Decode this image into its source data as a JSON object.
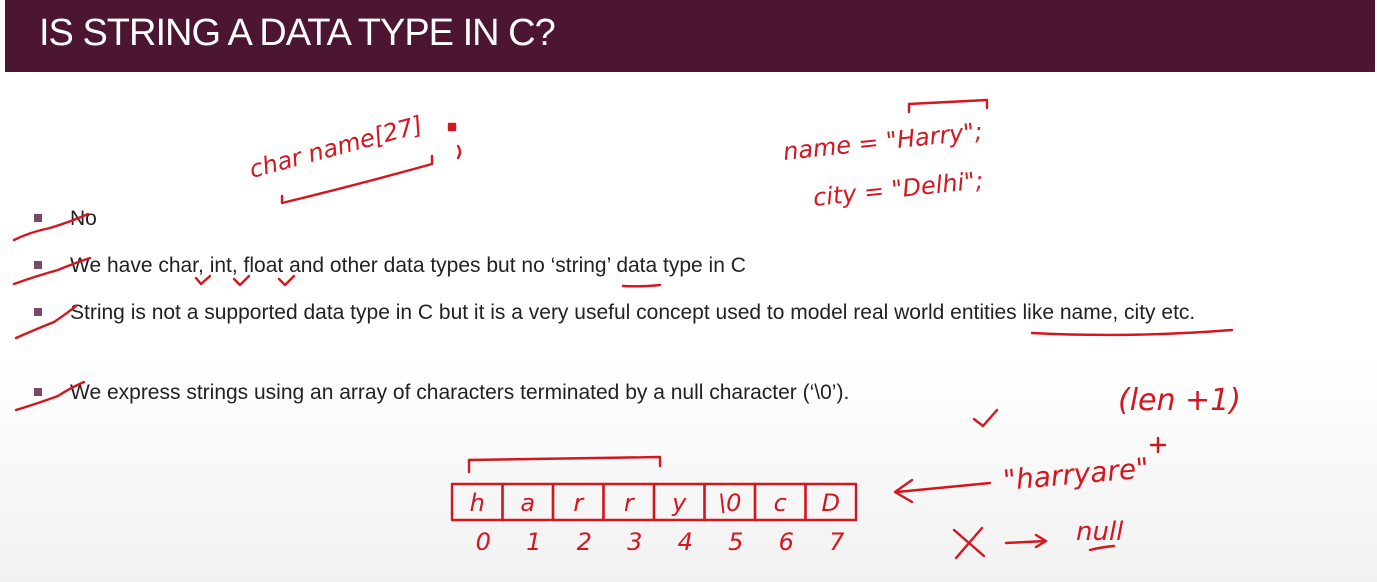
{
  "slide": {
    "title": "IS STRING A DATA TYPE IN C?",
    "colors": {
      "title_bar": "#4c1532",
      "annotation_ink": "#d4161f",
      "bullet": "#7a4868"
    }
  },
  "bullets": [
    {
      "text": "No"
    },
    {
      "text": "We have char, int, float and other data types but no ‘string’ data type in C"
    },
    {
      "text": "String is not a supported data type in C but it is a very useful concept used to model real world entities like name, city etc."
    },
    {
      "text": "We express strings using an array of characters terminated by a null character (‘\\0’)."
    }
  ],
  "annotations": {
    "declaration": "char name[27]",
    "name_assignment": "name = \"Harry\";",
    "city_assignment": "city = \"Delhi\";",
    "length_note": "(len +1)",
    "string_example": "\"harryare\"",
    "array_cells": [
      "h",
      "a",
      "r",
      "r",
      "y",
      "\\0",
      "c",
      "D"
    ],
    "array_indices": [
      "0",
      "1",
      "2",
      "3",
      "4",
      "5",
      "6",
      "7"
    ],
    "null_note": "null"
  }
}
